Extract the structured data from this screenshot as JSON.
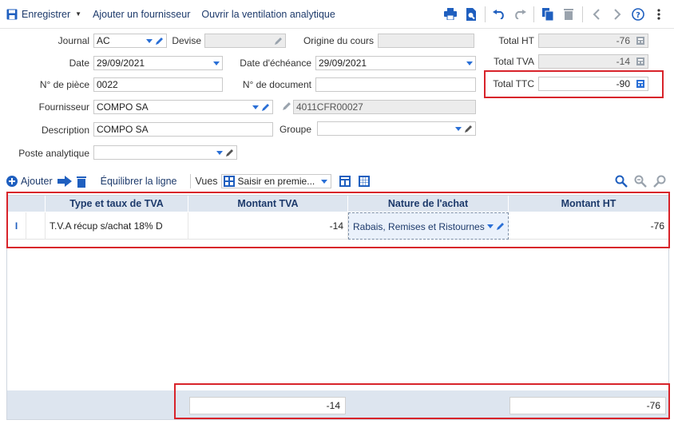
{
  "toolbar": {
    "save_label": "Enregistrer",
    "add_supplier_label": "Ajouter un fournisseur",
    "analytic_label": "Ouvrir la ventilation analytique"
  },
  "form": {
    "journal": {
      "label": "Journal",
      "value": "AC"
    },
    "devise": {
      "label": "Devise",
      "value": ""
    },
    "origine": {
      "label": "Origine du cours",
      "value": ""
    },
    "date": {
      "label": "Date",
      "value": "29/09/2021"
    },
    "echeance": {
      "label": "Date d'échéance",
      "value": "29/09/2021"
    },
    "piece": {
      "label": "N° de pièce",
      "value": "0022"
    },
    "document": {
      "label": "N° de document",
      "value": ""
    },
    "fournisseur": {
      "label": "Fournisseur",
      "value": "COMPO SA",
      "account": "4011CFR00027"
    },
    "description": {
      "label": "Description",
      "value": "COMPO SA"
    },
    "groupe": {
      "label": "Groupe",
      "value": ""
    },
    "poste": {
      "label": "Poste analytique",
      "value": ""
    }
  },
  "totals": {
    "ht": {
      "label": "Total HT",
      "value": "-76"
    },
    "tva": {
      "label": "Total TVA",
      "value": "-14"
    },
    "ttc": {
      "label": "Total TTC",
      "value": "-90"
    }
  },
  "grid_toolbar": {
    "add_label": "Ajouter",
    "balance_label": "Équilibrer la ligne",
    "views_label": "Vues",
    "view_value": "Saisir en premie..."
  },
  "grid": {
    "headers": [
      "Type et taux de TVA",
      "Montant TVA",
      "Nature de l'achat",
      "Montant HT"
    ],
    "row": {
      "indicator": "I",
      "type": "T.V.A récup s/achat 18% D",
      "montant_tva": "-14",
      "nature": "Rabais, Remises et Ristournes",
      "montant_ht": "-76"
    },
    "footer": {
      "total_tva": "-14",
      "total_ht": "-76"
    }
  },
  "colors": {
    "accent": "#2a6fd6",
    "header_text": "#1d3a6b",
    "highlight": "#d8232a",
    "grid_header": "#dde5ef"
  }
}
